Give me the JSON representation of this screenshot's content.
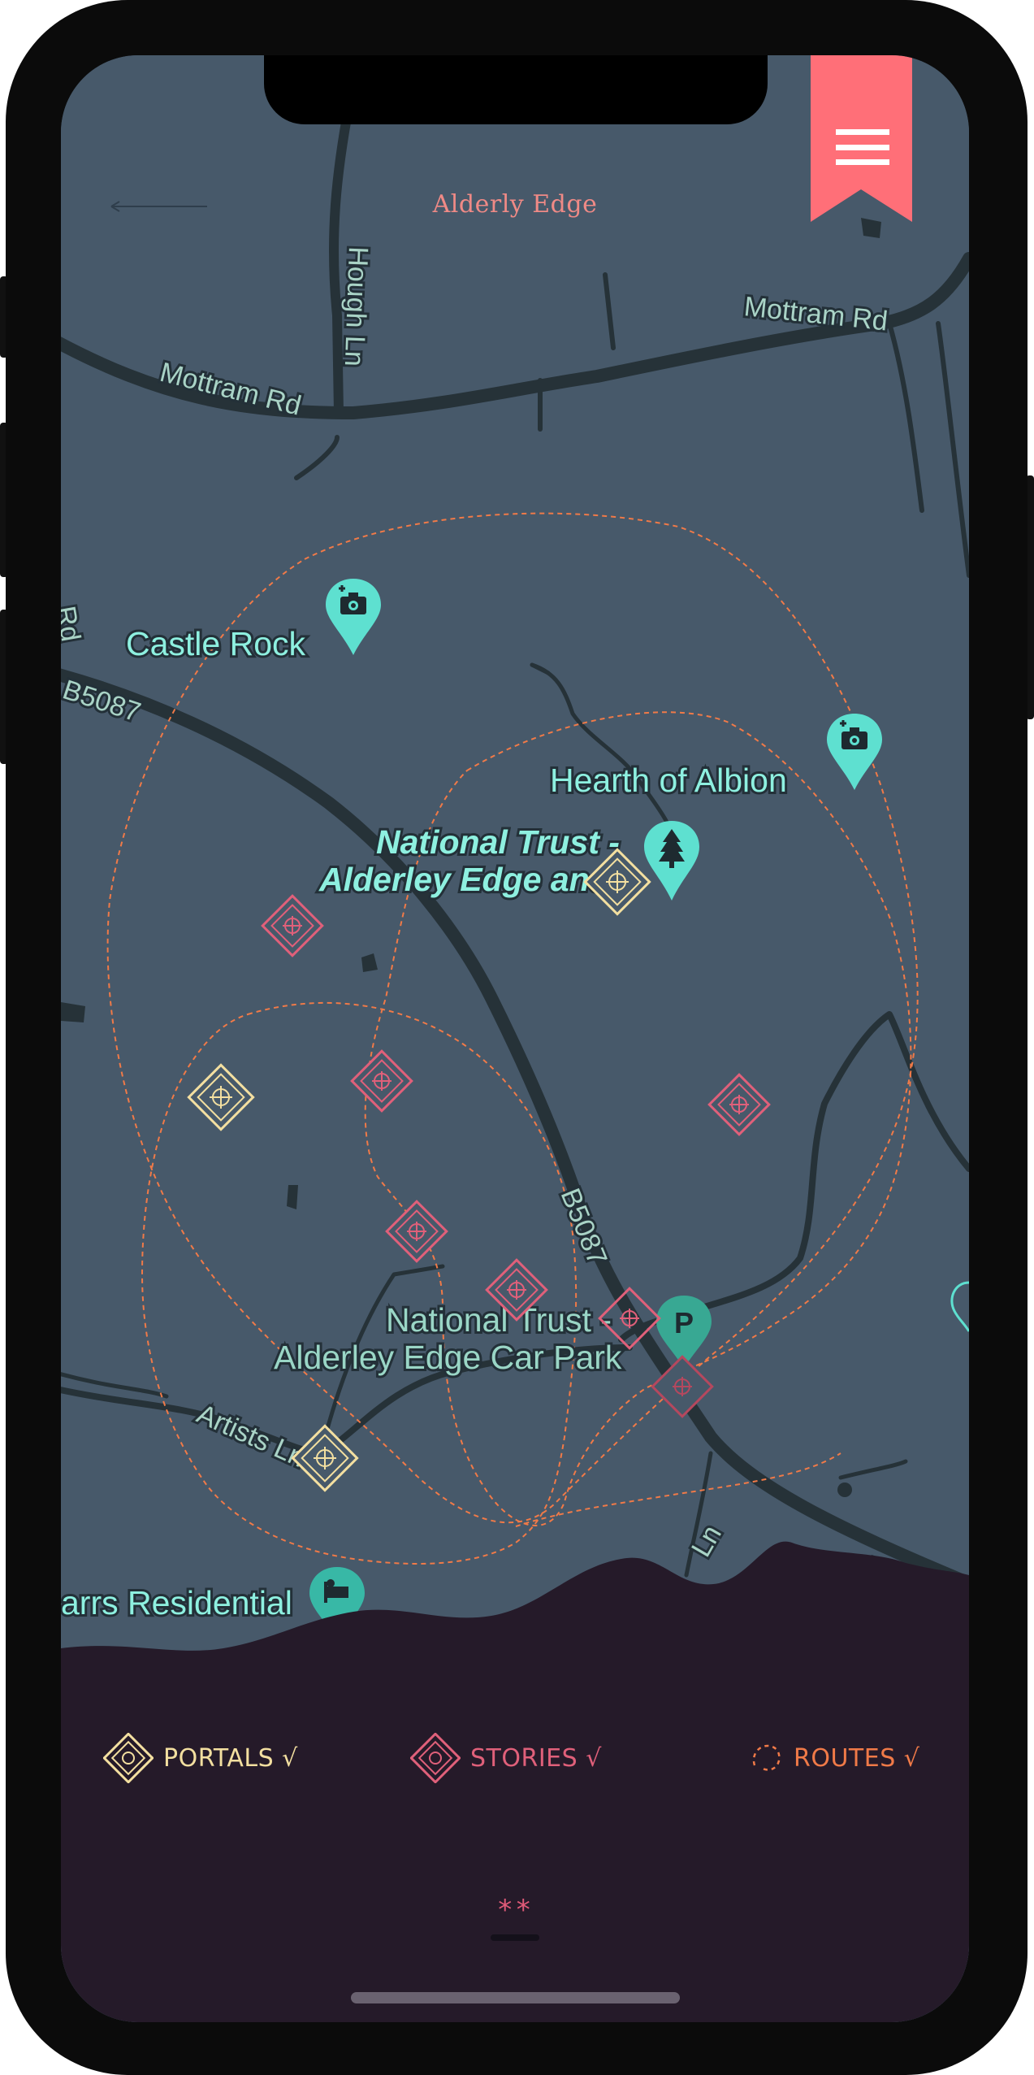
{
  "header": {
    "title": "Alderly Edge"
  },
  "map": {
    "roads": [
      "Hough Ln",
      "Mottram Rd",
      "Mottram Rd",
      "B5087",
      "B5087",
      "Artists Ln",
      "Rd",
      "Ln",
      "B5"
    ],
    "places": [
      {
        "name": "Castle Rock",
        "icon": "camera-pin-icon"
      },
      {
        "name": "Hearth of Albion",
        "icon": "camera-pin-icon"
      },
      {
        "name_line1": "National Trust -",
        "name_line2": "Alderley Edge and",
        "icon": "tree-pin-icon"
      },
      {
        "name_line1": "National Trust -",
        "name_line2": "Alderley Edge Car Park",
        "icon": "parking-pin-icon",
        "pin_text": "P"
      },
      {
        "name": "arrs Residential",
        "icon": "hotel-pin-icon"
      }
    ]
  },
  "legend": {
    "portals": "PORTALS √",
    "stories": "STORIES √",
    "routes": "ROUTES √"
  },
  "pager": {
    "dots": "**"
  },
  "colors": {
    "map_bg": "#47596a",
    "road": "#263238",
    "poi": "#5ee0d0",
    "portal": "#f3dfa0",
    "story": "#e0607a",
    "route": "#f07a48",
    "panel": "#251a29",
    "menu": "#ff6f78"
  }
}
